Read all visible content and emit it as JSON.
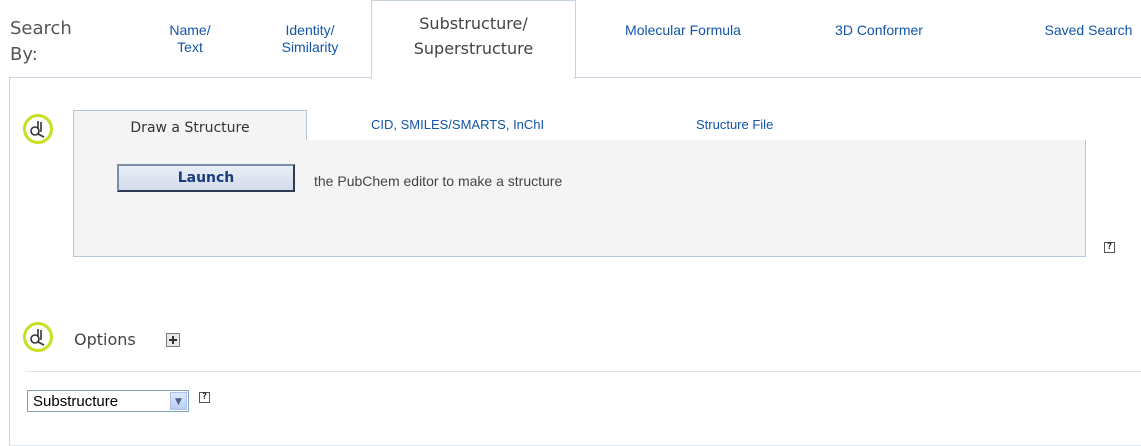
{
  "header": {
    "search_by_line1": "Search",
    "search_by_line2": "By:"
  },
  "tabs": [
    {
      "line1": "Name/",
      "line2": "Text"
    },
    {
      "line1": "Identity/",
      "line2": "Similarity"
    },
    {
      "line1": "Substructure/",
      "line2": "Superstructure"
    },
    {
      "label": "Molecular Formula"
    },
    {
      "label": "3D Conformer"
    },
    {
      "label": "Saved Search"
    }
  ],
  "structure": {
    "subtabs": [
      "Draw a Structure",
      "CID, SMILES/SMARTS, InChI",
      "Structure File"
    ],
    "launch_label": "Launch",
    "launch_description": "the PubChem editor to make a structure",
    "help_glyph": "?"
  },
  "options": {
    "label": "Options",
    "select_value": "Substructure",
    "help_glyph": "?"
  },
  "colors": {
    "link": "#1255a8",
    "icon_ring": "#c8e020",
    "border": "#c8d4e0"
  }
}
